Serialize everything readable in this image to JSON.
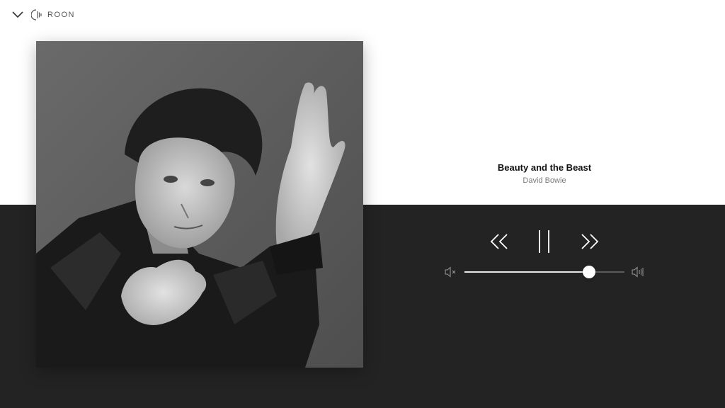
{
  "app": {
    "brand_label": "ROON"
  },
  "header": {
    "collapse_icon": "chevron-down-icon",
    "logo_icon": "roon-logo-icon"
  },
  "now_playing": {
    "title": "Beauty and the Beast",
    "artist": "David Bowie",
    "album_art": "album-cover-portrait"
  },
  "transport": {
    "prev_icon": "double-chevron-left-icon",
    "pause_icon": "pause-icon",
    "next_icon": "double-chevron-right-icon"
  },
  "volume": {
    "level": 0.78,
    "min_icon": "speaker-mute-icon",
    "max_icon": "speaker-loud-icon"
  },
  "colors": {
    "top_background": "#ffffff",
    "bottom_background": "#232323",
    "control_color": "#ffffff",
    "title_color": "#111111",
    "artist_color": "#7a7a7a"
  }
}
